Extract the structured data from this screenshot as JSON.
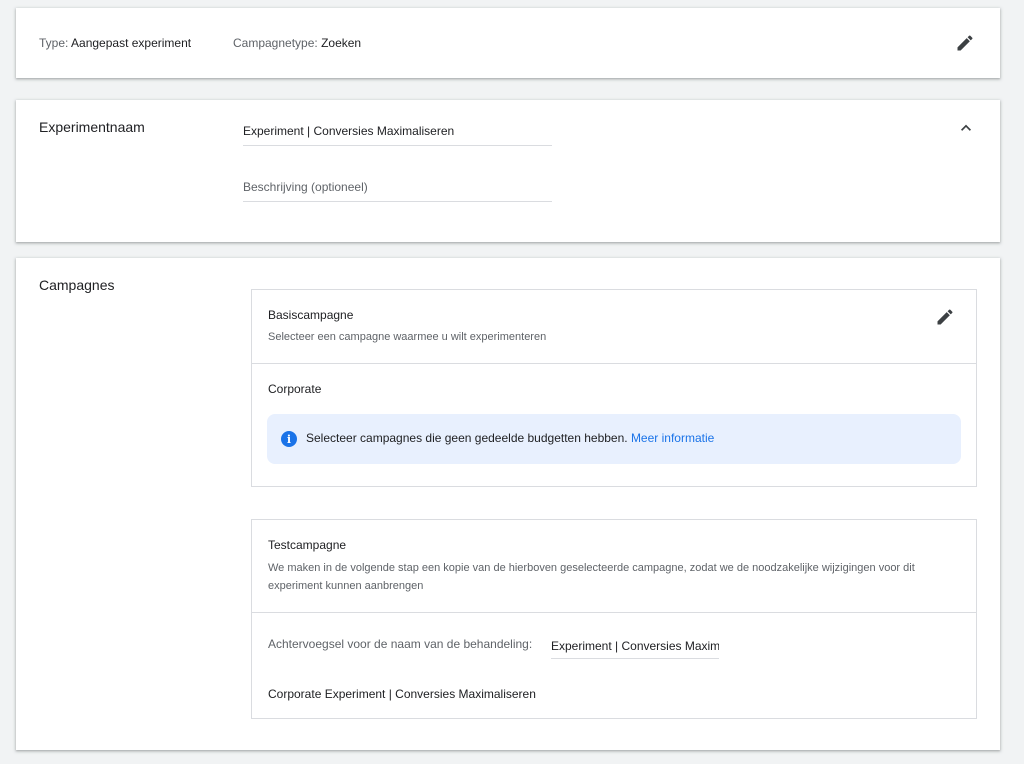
{
  "summary": {
    "type_label": "Type:",
    "type_value": "Aangepast experiment",
    "campaign_type_label": "Campagnetype:",
    "campaign_type_value": "Zoeken",
    "edit_icon": "pencil-icon"
  },
  "experiment": {
    "section_title": "Experimentnaam",
    "name_value": "Experiment | Conversies Maximaliseren",
    "description_placeholder": "Beschrijving (optioneel)",
    "collapse_icon": "chevron-up-icon"
  },
  "campaigns": {
    "section_title": "Campagnes",
    "base": {
      "title": "Basiscampagne",
      "description": "Selecteer een campagne waarmee u wilt experimenteren",
      "selected": "Corporate",
      "edit_icon": "pencil-icon",
      "info_text": "Selecteer campagnes die geen gedeelde budgetten hebben.",
      "info_link": "Meer informatie",
      "info_icon": "info-icon"
    },
    "test": {
      "title": "Testcampagne",
      "description": "We maken in de volgende stap een kopie van de hierboven geselecteerde campagne, zodat we de noodzakelijke wijzigingen voor dit experiment kunnen aanbrengen",
      "suffix_label": "Achtervoegsel voor de naam van de behandeling:",
      "suffix_value": "Experiment | Conversies Maximaliseren",
      "result_name": "Corporate Experiment | Conversies Maximaliseren"
    }
  },
  "colors": {
    "accent": "#1a73e8",
    "info_bg": "#e8f0fe",
    "page_bg": "#f1f3f4"
  }
}
